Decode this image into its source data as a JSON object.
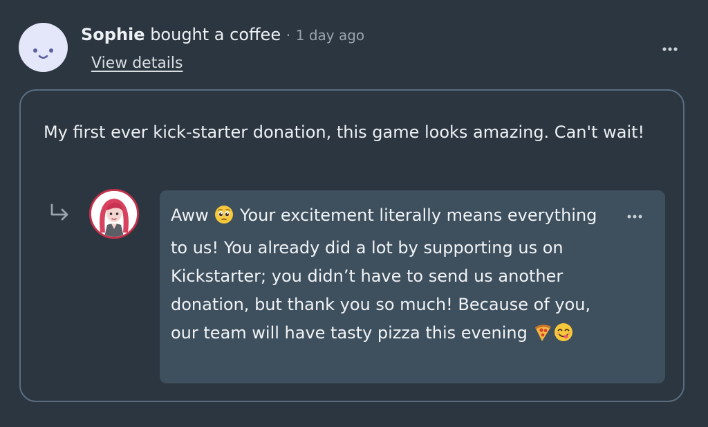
{
  "post": {
    "author": "Sophie",
    "action": "bought a coffee",
    "separator": "·",
    "timestamp": "1 day ago",
    "view_details_label": "View details",
    "message": "My first ever kick-starter donation, this game looks amazing. Can't wait!"
  },
  "reply": {
    "part1": "Aww",
    "part2": "Your excitement literally means everything to us! You already did a lot by supporting us on Kickstarter; you didn’t have to send us another donation, but thank you so much! Because of you, our team will have tasty pizza this evening"
  },
  "icons": {
    "reply_arrow": "reply-arrow-icon",
    "more": "more-horizontal-icon",
    "pleading_face": "pleading-face-emoji",
    "pizza": "pizza-emoji",
    "yum_face": "yum-face-emoji"
  },
  "colors": {
    "background": "#2c3640",
    "card_border": "#5a6d80",
    "reply_bubble": "#3e4f5e",
    "avatar_sophie_bg": "#e4e7f9",
    "avatar_creator_ring": "#c2324b"
  }
}
